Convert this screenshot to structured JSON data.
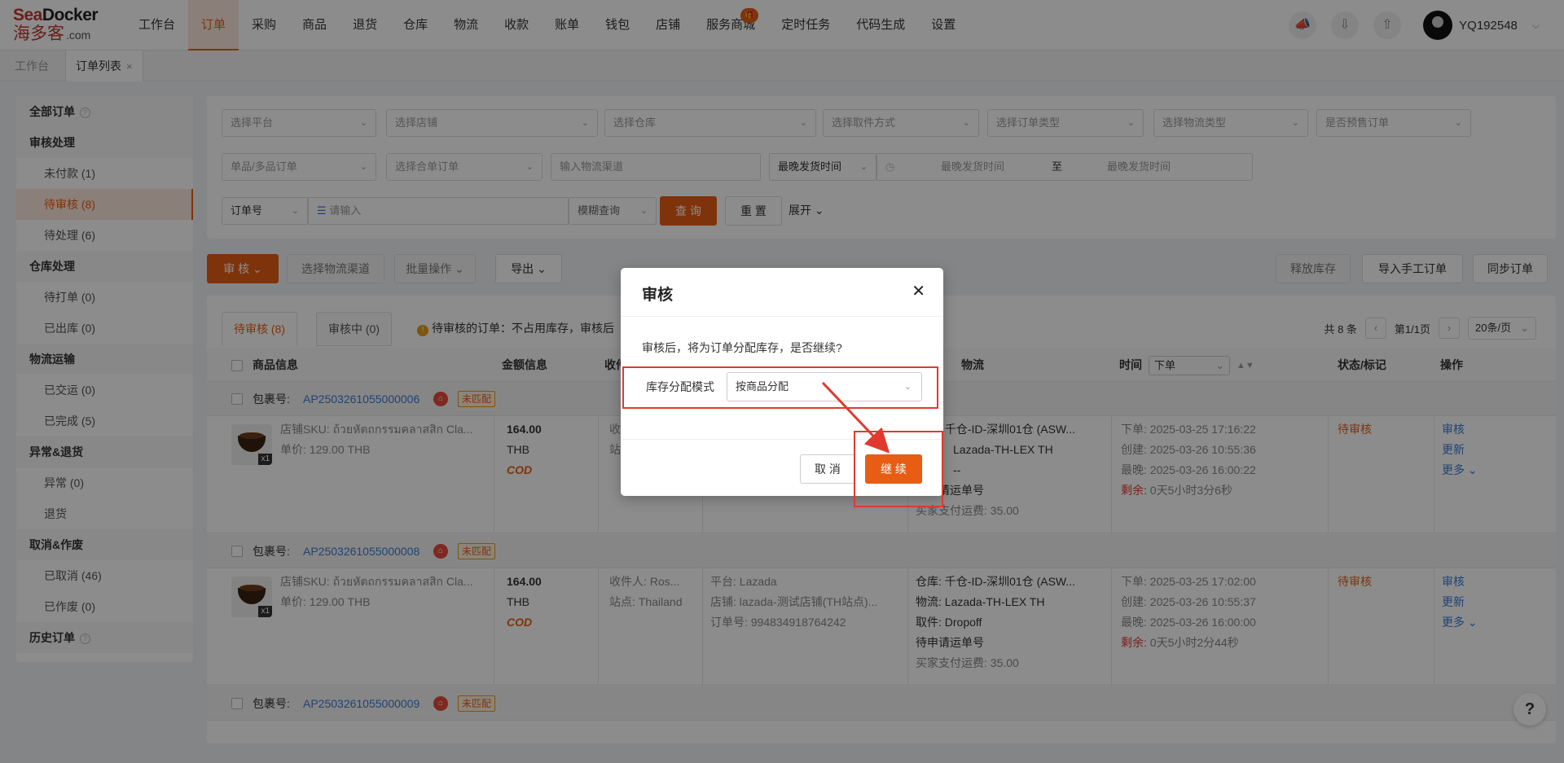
{
  "logo": {
    "line1a": "Sea",
    "line1b": "Docker",
    "line2": "海多客",
    "line2b": ".com"
  },
  "nav": {
    "items": [
      "工作台",
      "订单",
      "采购",
      "商品",
      "退货",
      "仓库",
      "物流",
      "收款",
      "账单",
      "钱包",
      "店铺",
      "服务商城",
      "定时任务",
      "代码生成",
      "设置"
    ],
    "active_index": 1,
    "badge_index": 11,
    "badge_icon": "gift-icon"
  },
  "top_icons": [
    "megaphone-icon",
    "download-icon",
    "upload-icon"
  ],
  "user": {
    "name": "YQ192548"
  },
  "tabs": {
    "home": "工作台",
    "current": "订单列表",
    "close": "×"
  },
  "sidebar": {
    "items": [
      {
        "label": "全部订单",
        "type": "header",
        "help": true
      },
      {
        "label": "审核处理",
        "type": "header"
      },
      {
        "label": "未付款 (1)",
        "type": "child"
      },
      {
        "label": "待审核 (8)",
        "type": "child",
        "active": true
      },
      {
        "label": "待处理 (6)",
        "type": "child"
      },
      {
        "label": "仓库处理",
        "type": "header"
      },
      {
        "label": "待打单 (0)",
        "type": "child"
      },
      {
        "label": "已出库 (0)",
        "type": "child"
      },
      {
        "label": "物流运输",
        "type": "header"
      },
      {
        "label": "已交运 (0)",
        "type": "child"
      },
      {
        "label": "已完成 (5)",
        "type": "child"
      },
      {
        "label": "异常&退货",
        "type": "header"
      },
      {
        "label": "异常 (0)",
        "type": "child"
      },
      {
        "label": "退货",
        "type": "child"
      },
      {
        "label": "取消&作废",
        "type": "header"
      },
      {
        "label": "已取消 (46)",
        "type": "child"
      },
      {
        "label": "已作废 (0)",
        "type": "child"
      },
      {
        "label": "历史订单",
        "type": "header",
        "help": true
      }
    ]
  },
  "filters": {
    "platform": "选择平台",
    "shop": "选择店铺",
    "warehouse": "选择仓库",
    "pickup": "选择取件方式",
    "order_type": "选择订单类型",
    "logistics_type": "选择物流类型",
    "presale": "是否预售订单",
    "sku_type": "单品/多品订单",
    "merge": "选择合单订单",
    "channel_input": "输入物流渠道",
    "time_field": "最晚发货时间",
    "time_start": "最晚发货时间",
    "time_to": "至",
    "time_end": "最晚发货时间",
    "order_no": "订单号",
    "search_placeholder": "请输入",
    "fuzzy": "模糊查询",
    "query": "查 询",
    "reset": "重 置",
    "expand": "展开"
  },
  "toolbar": {
    "audit": "审 核",
    "select_channel": "选择物流渠道",
    "batch": "批量操作",
    "export": "导出",
    "release": "释放库存",
    "import": "导入手工订单",
    "sync": "同步订单"
  },
  "list": {
    "tabs": [
      "待审核 (8)",
      "审核中 (0)"
    ],
    "tip": "待审核的订单：不占用库存，审核后",
    "pager": {
      "total": "共 8 条",
      "prev": "‹",
      "page": "第1/1页",
      "next": "›",
      "size": "20条/页"
    },
    "headers": {
      "product": "商品信息",
      "amount": "金额信息",
      "receiver": "收件",
      "logistics": "物流",
      "time": "时间",
      "time_sel": "下单",
      "status": "状态/标记",
      "ops": "操作"
    },
    "packages": [
      {
        "label": "包裹号:",
        "no": "AP2503261055000006",
        "badge": "未匹配",
        "sku": "店铺SKU: ถ้วยหัตถกรรมคลาสสิก Cla...",
        "price": "单价: 129.00 THB",
        "qty": "x1",
        "amount": "164.00",
        "currency": "THB",
        "cod": "COD",
        "recv1": "收",
        "recv2": "站",
        "wh": "仓库: 千仓-ID-深圳01仓 (ASW...",
        "lg": "Lazada-TH-LEX TH",
        "pk": "--",
        "track": "待申请运单号",
        "fee": "买家支付运费: 35.00",
        "t1": "下单: 2025-03-25 17:16:22",
        "t2": "创建: 2025-03-26 10:55:36",
        "t3": "最晚: 2025-03-26 16:00:22",
        "t4a": "剩余:",
        "t4b": " 0天5小时3分6秒",
        "status": "待审核",
        "op1": "审核",
        "op2": "更新",
        "op3": "更多"
      },
      {
        "label": "包裹号:",
        "no": "AP2503261055000008",
        "badge": "未匹配",
        "sku": "店铺SKU: ถ้วยหัตถกรรมคลาสสิก Cla...",
        "price": "单价: 129.00 THB",
        "qty": "x1",
        "amount": "164.00",
        "currency": "THB",
        "cod": "COD",
        "recv1": "收件人: Ros...",
        "recv2": "站点: Thailand",
        "plat1": "平台: Lazada",
        "plat2": "店铺: lazada-测试店铺(TH站点)...",
        "plat3": "订单号: 994834918764242",
        "wh": "仓库: 千仓-ID-深圳01仓 (ASW...",
        "lg": "物流: Lazada-TH-LEX TH",
        "pk": "取件: Dropoff",
        "track": "待申请运单号",
        "fee": "买家支付运费: 35.00",
        "t1": "下单: 2025-03-25 17:02:00",
        "t2": "创建: 2025-03-26 10:55:37",
        "t3": "最晚: 2025-03-26 16:00:00",
        "t4a": "剩余:",
        "t4b": " 0天5小时2分44秒",
        "status": "待审核",
        "op1": "审核",
        "op2": "更新",
        "op3": "更多"
      },
      {
        "label": "包裹号:",
        "no": "AP2503261055000009",
        "badge": "未匹配"
      }
    ]
  },
  "modal": {
    "title": "审核",
    "close": "✕",
    "message": "审核后，将为订单分配库存，是否继续?",
    "label": "库存分配模式",
    "select_value": "按商品分配",
    "cancel": "取 消",
    "ok": "继 续"
  },
  "help": "?"
}
